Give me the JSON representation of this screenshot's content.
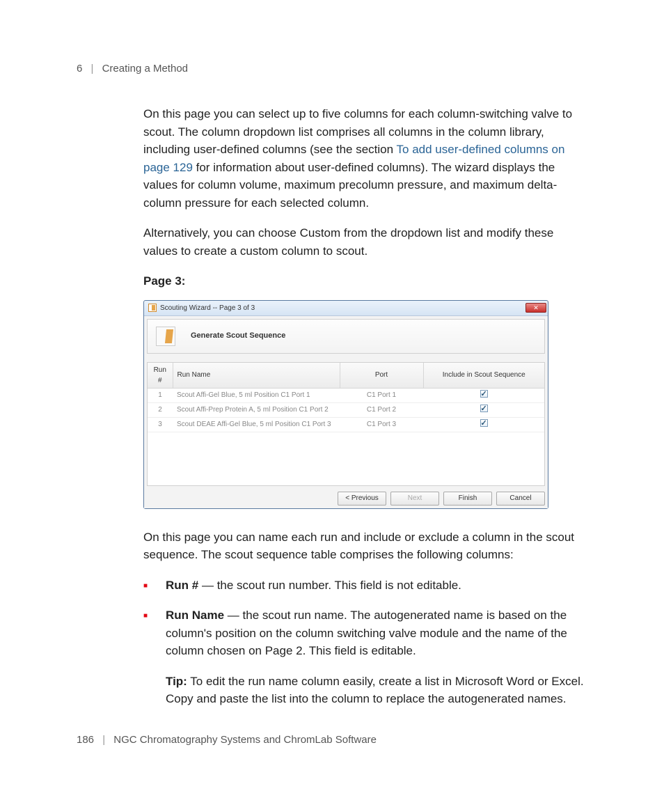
{
  "header": {
    "chapter_number": "6",
    "chapter_title": "Creating a Method"
  },
  "footer": {
    "page_number": "186",
    "doc_title": "NGC Chromatography Systems and ChromLab Software"
  },
  "body": {
    "p1a": "On this page you can select up to five columns for each column-switching valve to scout. The column dropdown list comprises all columns in the column library, including user-defined columns (see the section ",
    "p1_link": "To add user-defined columns on page 129",
    "p1b": " for information about user-defined columns). The wizard displays the values for column volume, maximum precolumn pressure, and maximum delta-column pressure for each selected column.",
    "p2": "Alternatively, you can choose Custom from the dropdown list and modify these values to create a custom column to scout.",
    "heading_page3": "Page 3:",
    "p3": "On this page you can name each run and include or exclude a column in the scout sequence. The scout sequence table comprises the following columns:",
    "bullets": [
      {
        "term": "Run #",
        "dash": " — ",
        "desc": "the scout run number. This field is not editable."
      },
      {
        "term": "Run Name",
        "dash": " — ",
        "desc": "the scout run name. The autogenerated name is based on the column's position on the column switching valve module and the name of the column chosen on Page 2. This field is editable."
      }
    ],
    "tip_label": "Tip:",
    "tip_text": "   To edit the run name column easily, create a list in Microsoft Word or Excel. Copy and paste the list into the column to replace the autogenerated names."
  },
  "wizard": {
    "window_title": "Scouting Wizard -- Page 3 of 3",
    "panel_title": "Generate Scout Sequence",
    "columns": {
      "run": "Run #",
      "name": "Run Name",
      "port": "Port",
      "include": "Include in Scout Sequence"
    },
    "rows": [
      {
        "run": "1",
        "name": "Scout Affi-Gel Blue, 5 ml Position C1 Port 1",
        "port": "C1 Port 1",
        "include": true
      },
      {
        "run": "2",
        "name": "Scout Affi-Prep Protein A, 5 ml Position C1 Port 2",
        "port": "C1 Port 2",
        "include": true
      },
      {
        "run": "3",
        "name": "Scout DEAE Affi-Gel Blue, 5 ml  Position C1 Port 3",
        "port": "C1 Port 3",
        "include": true
      }
    ],
    "buttons": {
      "previous": "< Previous",
      "next": "Next",
      "finish": "Finish",
      "cancel": "Cancel"
    }
  }
}
